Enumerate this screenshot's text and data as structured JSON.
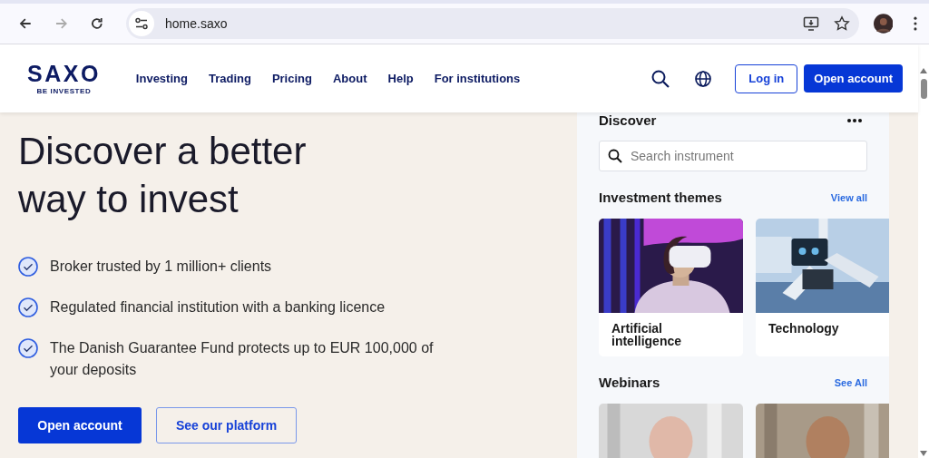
{
  "browser": {
    "url": "home.saxo"
  },
  "header": {
    "logo": {
      "name": "SAXO",
      "tagline": "BE INVESTED"
    },
    "nav": [
      {
        "label": "Investing"
      },
      {
        "label": "Trading"
      },
      {
        "label": "Pricing"
      },
      {
        "label": "About"
      },
      {
        "label": "Help"
      },
      {
        "label": "For institutions"
      }
    ],
    "login": "Log in",
    "open_account": "Open account"
  },
  "hero": {
    "title": "Discover a better way to invest",
    "features": [
      {
        "text": "Broker trusted by 1 million+ clients"
      },
      {
        "text": "Regulated financial institution with a banking licence"
      },
      {
        "text": "The Danish Guarantee Fund protects up to EUR 100,000 of your deposits"
      }
    ],
    "buttons": [
      {
        "label": "Open account",
        "kind": "primary"
      },
      {
        "label": "See our platform",
        "kind": "secondary"
      }
    ]
  },
  "discover": {
    "title": "Discover",
    "search": {
      "placeholder": "Search instrument"
    },
    "themes": {
      "title": "Investment themes",
      "link": "View all",
      "cards": [
        {
          "label": "Artificial intelligence",
          "kind": "picture"
        },
        {
          "label": "Technology",
          "kind": "picture"
        }
      ]
    },
    "webinars": {
      "title": "Webinars",
      "link": "See All"
    }
  }
}
